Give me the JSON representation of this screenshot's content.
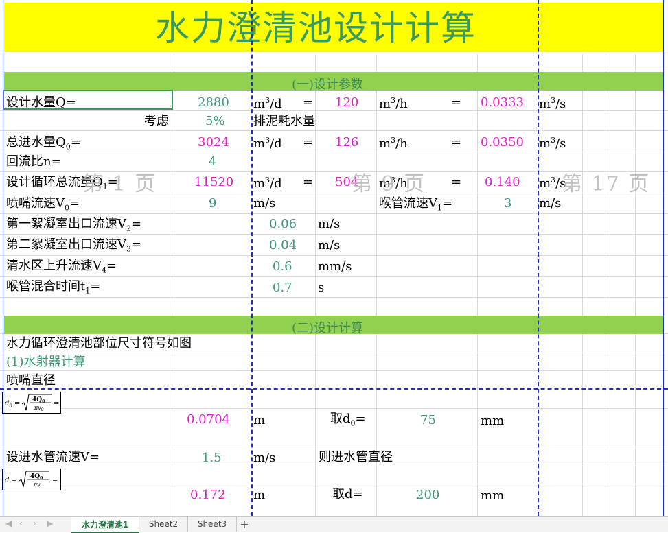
{
  "title": "水力澄清池设计计算",
  "sections": {
    "s1": "(一)设计参数",
    "s2": "(二)设计计算"
  },
  "rows": {
    "q": {
      "label": "设计水量Q=",
      "v1": "2880",
      "u1": "m",
      "u1s": "3",
      "u1b": "/d",
      "eq1": "=",
      "v2": "120",
      "u2": "m",
      "u2s": "3",
      "u2b": "/h",
      "eq2": "=",
      "v3": "0.0333",
      "u3": "m",
      "u3s": "3",
      "u3b": "/s"
    },
    "consider": {
      "label": "考虑",
      "v": "5%",
      "desc": "排泥耗水量"
    },
    "q0": {
      "label": "总进水量Q",
      "sub": "0",
      "tail": "=",
      "v1": "3024",
      "u1": "m",
      "u1s": "3",
      "u1b": "/d",
      "eq1": "=",
      "v2": "126",
      "u2": "m",
      "u2s": "3",
      "u2b": "/h",
      "eq2": "=",
      "v3": "0.0350",
      "u3": "m",
      "u3s": "3",
      "u3b": "/s"
    },
    "n": {
      "label": "回流比n=",
      "v": "4"
    },
    "q1": {
      "label": "设计循环总流量Q",
      "sub": "1",
      "tail": "=",
      "v1": "11520",
      "u1": "m",
      "u1s": "3",
      "u1b": "/d",
      "eq1": "=",
      "v2": "504",
      "u2": "m",
      "u2s": "3",
      "u2b": "/h",
      "eq2": "=",
      "v3": "0.140",
      "u3": "m",
      "u3s": "3",
      "u3b": "/s"
    },
    "v0": {
      "label": "喷嘴流速V",
      "sub": "0",
      "tail": "=",
      "v": "9",
      "u": "m/s",
      "label2": "喉管流速V",
      "sub2": "1",
      "tail2": "=",
      "v2": "3",
      "u2": "m/s"
    },
    "v2": {
      "label": "第一絮凝室出口流速V",
      "sub": "2",
      "tail": "=",
      "v": "0.06",
      "u": "m/s"
    },
    "v3": {
      "label": "第二絮凝室出口流速V",
      "sub": "3",
      "tail": "=",
      "v": "0.04",
      "u": "m/s"
    },
    "v4": {
      "label": "清水区上升流速V",
      "sub": "4",
      "tail": "=",
      "v": "0.6",
      "u": "mm/s"
    },
    "t1": {
      "label": "喉管混合时间t",
      "sub": "1",
      "tail": "=",
      "v": "0.7",
      "u": "s"
    },
    "fig": {
      "label": "水力循环澄清池部位尺寸符号如图"
    },
    "ejector": {
      "label": "(1)水射器计算"
    },
    "nozzle": {
      "label": "喷嘴直径"
    },
    "d0": {
      "v": "0.0704",
      "u": "m",
      "take": "取d",
      "takesub": "0",
      "taketail": "=",
      "tv": "75",
      "tu": "mm"
    },
    "inflow": {
      "label": "设进水管流速V=",
      "v": "1.5",
      "u": "m/s",
      "desc": "则进水管直径"
    },
    "d": {
      "v": "0.172",
      "u": "m",
      "take": "取d=",
      "tv": "200",
      "tu": "mm"
    }
  },
  "formulas": {
    "f1": {
      "lhs": "d",
      "lhs_sub": "0",
      "num": "4Q",
      "num_sub": "0",
      "den": "πv",
      "den_sub": "0"
    },
    "f2": {
      "lhs": "d",
      "num": "4Q",
      "num_sub": "0",
      "den": "πv"
    }
  },
  "watermarks": [
    "第 1 页",
    "第 9 页",
    "第 17 页"
  ],
  "tabs": [
    "水力澄清池1",
    "Sheet2",
    "Sheet3"
  ],
  "add_tab": "+",
  "colors": {
    "title_bg": "#ffff00",
    "title_text": "#3a9a5a",
    "band": "#92d050",
    "value_pink": "#e61ecf",
    "value_teal": "#3a9a7a",
    "page_break": "#1f2fd0"
  }
}
